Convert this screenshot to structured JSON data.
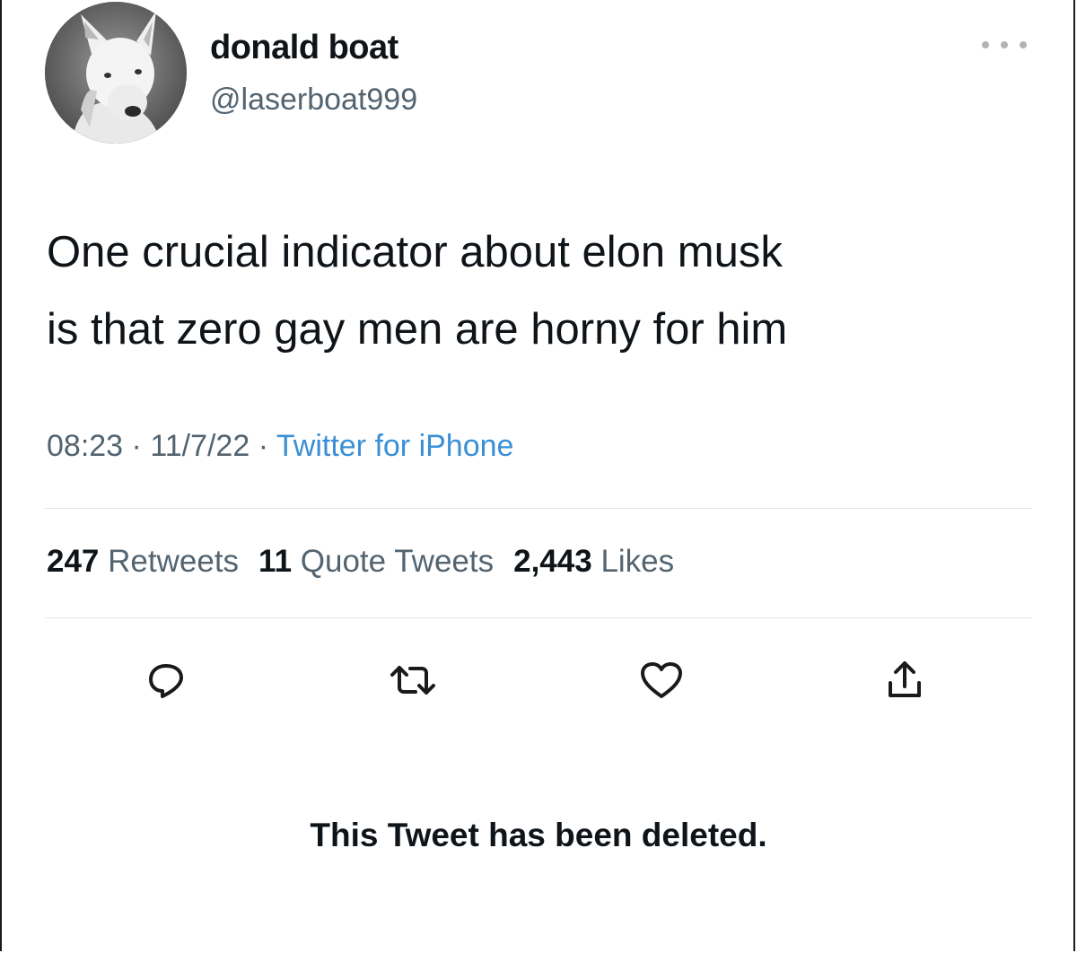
{
  "tweet": {
    "display_name": "donald boat",
    "handle": "@laserboat999",
    "text_line1": "One crucial indicator about elon musk",
    "text_line2": "is that zero gay men are horny for him",
    "time": "08:23",
    "date": "11/7/22",
    "separator": "·",
    "source": "Twitter for iPhone"
  },
  "stats": {
    "retweets_count": "247",
    "retweets_label": "Retweets",
    "quotes_count": "11",
    "quotes_label": "Quote Tweets",
    "likes_count": "2,443",
    "likes_label": "Likes"
  },
  "actions": {
    "reply_icon": "reply-icon",
    "retweet_icon": "retweet-icon",
    "like_icon": "heart-icon",
    "share_icon": "share-icon"
  },
  "notice": {
    "deleted": "This Tweet has been deleted."
  },
  "colors": {
    "text_primary": "#0f1419",
    "text_secondary": "#536471",
    "link": "#3a8fd6",
    "divider": "#e3e6e8"
  }
}
